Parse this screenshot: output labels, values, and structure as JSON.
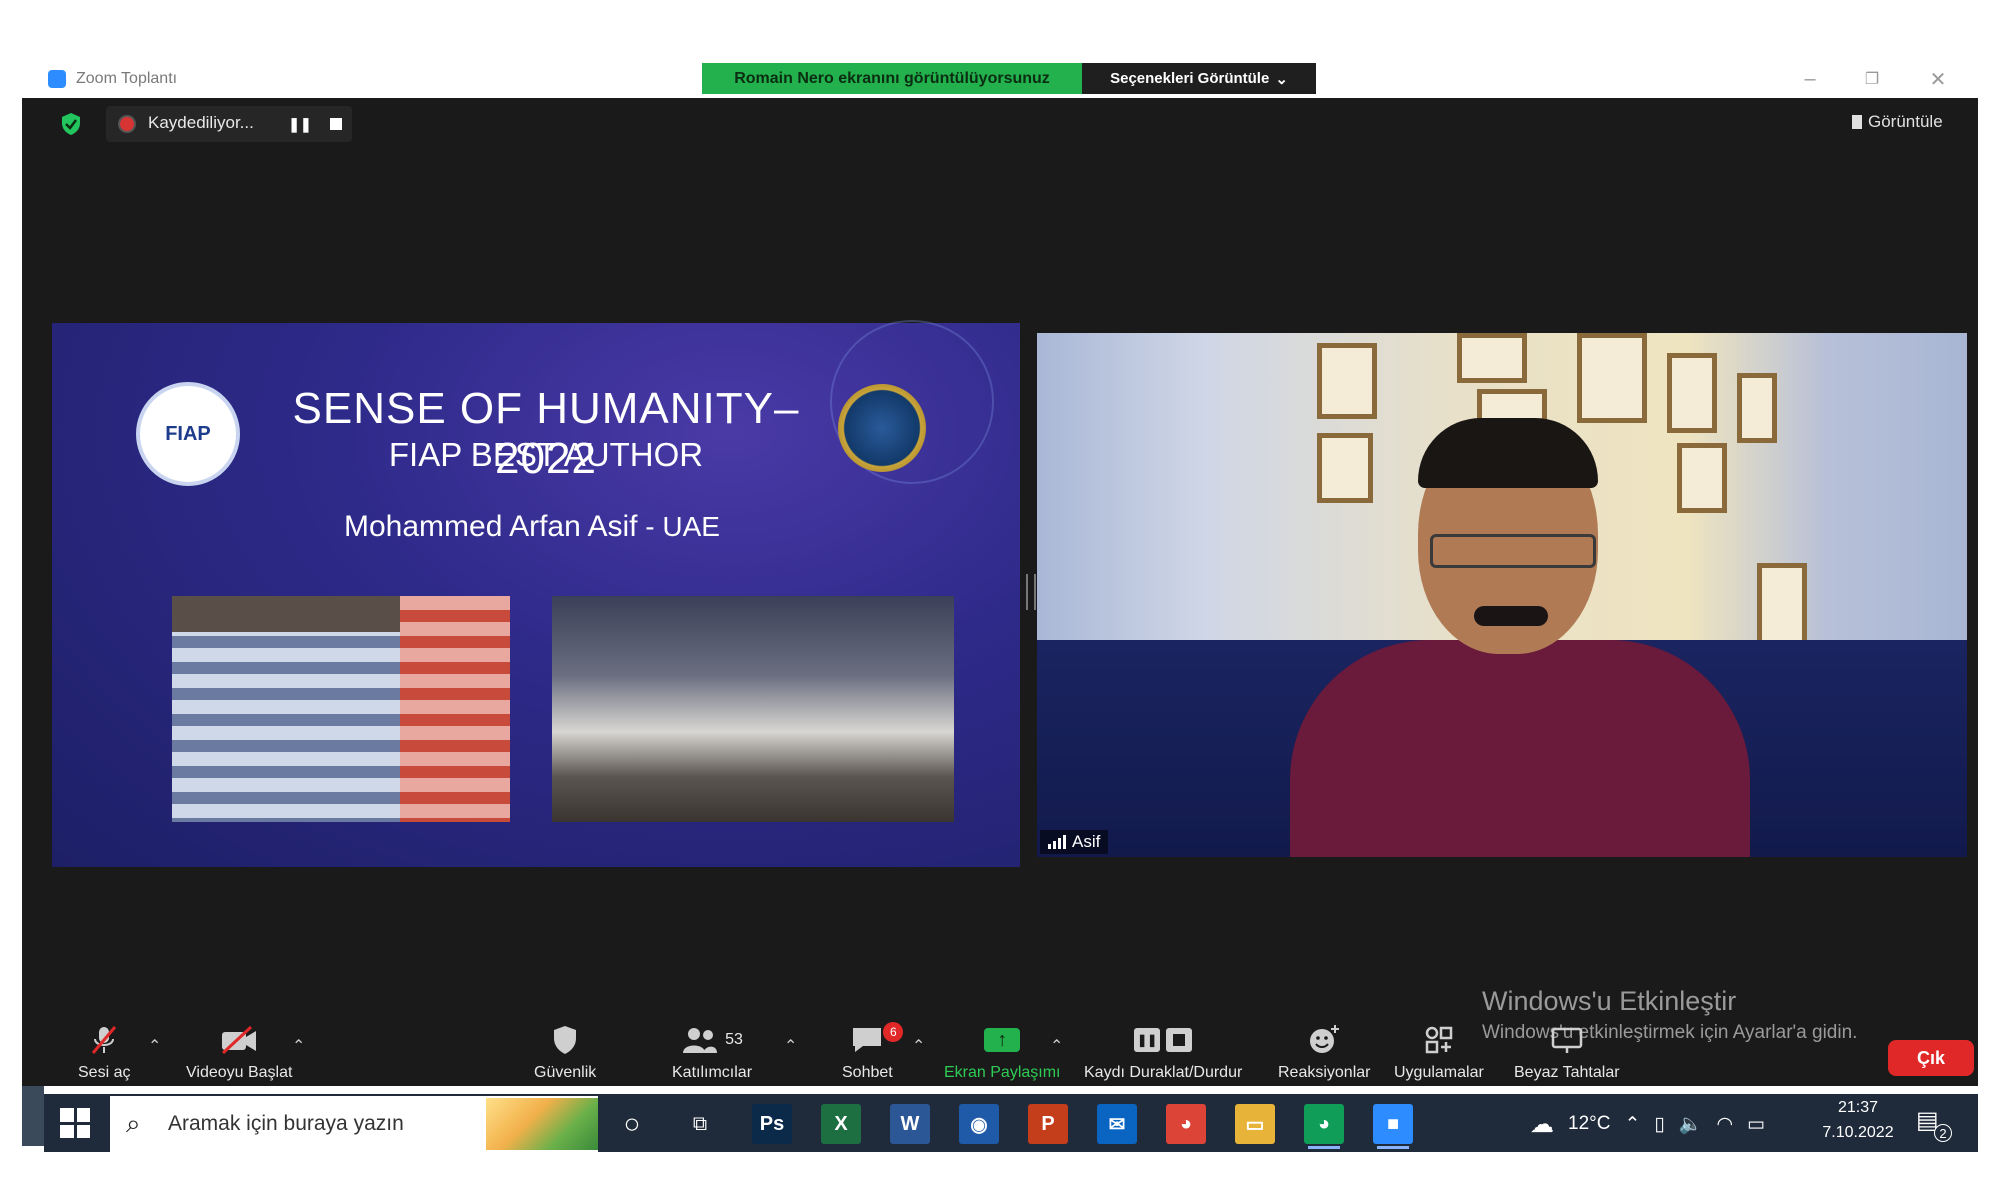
{
  "window": {
    "title": "Zoom Toplantı",
    "share_banner": "Romain Nero ekranını görüntülüyorsunuz",
    "options_button": "Seçenekleri Görüntüle",
    "controls": {
      "minimize": "–",
      "restore": "❐",
      "close": "✕"
    }
  },
  "meeting_header": {
    "recording_label": "Kaydediliyor...",
    "view_button": "Görüntüle"
  },
  "slide": {
    "title": "SENSE OF HUMANITY– 2022",
    "subtitle": "FIAP BEST AUTHOR",
    "author": "Mohammed Arfan Asif",
    "author_country": " - UAE",
    "seal_text": "FIAP"
  },
  "video": {
    "participant_name": "Asif"
  },
  "toolbar": {
    "mute": {
      "label": "Sesi aç",
      "icon": "mic-muted-icon"
    },
    "video": {
      "label": "Videoyu Başlat",
      "icon": "camera-off-icon"
    },
    "security": {
      "label": "Güvenlik",
      "icon": "shield-icon"
    },
    "participants": {
      "label": "Katılımcılar",
      "count": "53",
      "icon": "participants-icon"
    },
    "chat": {
      "label": "Sohbet",
      "badge": "6",
      "icon": "chat-icon"
    },
    "share": {
      "label": "Ekran Paylaşımı",
      "icon": "share-arrow-icon"
    },
    "record": {
      "label": "Kaydı Duraklat/Durdur",
      "icon": "pause-stop-icon"
    },
    "reactions": {
      "label": "Reaksiyonlar",
      "icon": "emoji-icon"
    },
    "apps": {
      "label": "Uygulamalar",
      "icon": "apps-icon"
    },
    "whiteboard": {
      "label": "Beyaz Tahtalar",
      "icon": "whiteboard-icon"
    },
    "leave": {
      "label": "Çık"
    }
  },
  "activation_notice": {
    "title": "Windows'u Etkinleştir",
    "subtitle": "Windows'u etkinleştirmek için Ayarlar'a gidin."
  },
  "taskbar": {
    "search_placeholder": "Aramak için buraya yazın",
    "apps": [
      {
        "name": "photoshop",
        "label": "Ps",
        "color": "#0b2a4a"
      },
      {
        "name": "excel",
        "label": "X",
        "color": "#1d6f42"
      },
      {
        "name": "word",
        "label": "W",
        "color": "#2b5797"
      },
      {
        "name": "browser-globe",
        "label": "◉",
        "color": "#1e5aa8"
      },
      {
        "name": "powerpoint",
        "label": "P",
        "color": "#c43e1c"
      },
      {
        "name": "mail",
        "label": "✉",
        "color": "#0a64c2"
      },
      {
        "name": "chrome",
        "label": "◕",
        "color": "#db4437"
      },
      {
        "name": "file-explorer",
        "label": "▭",
        "color": "#e8b339"
      },
      {
        "name": "chrome-profile",
        "label": "◕",
        "color": "#0f9d58"
      },
      {
        "name": "zoom",
        "label": "■",
        "color": "#2d8cff"
      }
    ],
    "weather": "12°C",
    "time": "21:37",
    "date": "7.10.2022",
    "notification_count": "2"
  },
  "colors": {
    "zoom_bg": "#1a1a1a",
    "share_green": "#22b14c",
    "leave_red": "#e02828",
    "taskbar": "#1f2a3a"
  }
}
